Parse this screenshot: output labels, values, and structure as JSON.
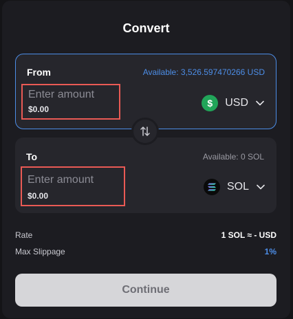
{
  "title": "Convert",
  "from": {
    "label": "From",
    "available": "Available: 3,526.597470266 USD",
    "amount_placeholder": "Enter amount",
    "amount_fiat": "$0.00",
    "asset_symbol": "$",
    "asset": "USD",
    "asset_icon": "usd-coin-icon"
  },
  "to": {
    "label": "To",
    "available": "Available: 0 SOL",
    "amount_placeholder": "Enter amount",
    "amount_fiat": "$0.00",
    "asset": "SOL",
    "asset_icon": "solana-icon"
  },
  "swap_icon": "swap-arrows-icon",
  "rate": {
    "label": "Rate",
    "value": "1 SOL ≈ - USD"
  },
  "slippage": {
    "label": "Max Slippage",
    "value": "1%"
  },
  "continue_label": "Continue",
  "colors": {
    "accent": "#4d8ee8",
    "highlight": "#ea5a55",
    "usd_green": "#21a559",
    "button_bg": "#d6d6d9"
  }
}
